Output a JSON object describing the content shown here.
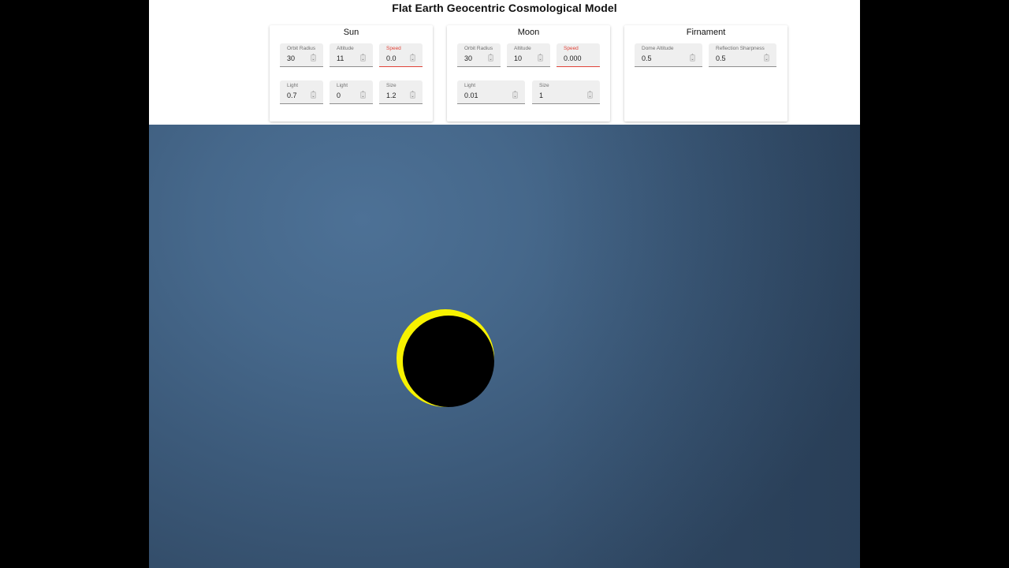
{
  "app": {
    "title": "Flat Earth Geocentric Cosmological Model"
  },
  "panels": {
    "sun": {
      "title": "Sun",
      "fields": {
        "orbit_radius": {
          "label": "Orbit Radius",
          "value": "30"
        },
        "altitude": {
          "label": "Altitude",
          "value": "11"
        },
        "speed": {
          "label": "Speed",
          "value": "0.0"
        },
        "light1": {
          "label": "Light",
          "value": "0.7"
        },
        "light2": {
          "label": "Light",
          "value": "0"
        },
        "size": {
          "label": "Size",
          "value": "1.2"
        }
      }
    },
    "moon": {
      "title": "Moon",
      "fields": {
        "orbit_radius": {
          "label": "Orbit Radius",
          "value": "30"
        },
        "altitude": {
          "label": "Altitude",
          "value": "10"
        },
        "speed": {
          "label": "Speed",
          "value": "0.000"
        },
        "light": {
          "label": "Light",
          "value": "0.01"
        },
        "size": {
          "label": "Size",
          "value": "1"
        }
      }
    },
    "firmament": {
      "title": "Firnament",
      "fields": {
        "dome_altitude": {
          "label": "Dome Altitude",
          "value": "0.5"
        },
        "reflection_sharpness": {
          "label": "Reflection Sharpness",
          "value": "0.5"
        }
      }
    }
  },
  "colors": {
    "error_accent": "#e0443a",
    "sun": "#f7f200",
    "moon": "#000000",
    "sky": "#46688b"
  },
  "icons": {
    "spinner": "number-stepper-icon"
  }
}
